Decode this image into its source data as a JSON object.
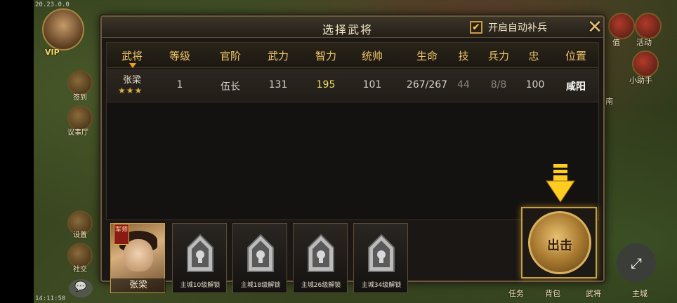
{
  "status": {
    "time_top": "20.23.0.0",
    "time_bottom": "14:11:50"
  },
  "hud": {
    "vip": "VIP",
    "left_items": [
      {
        "label": "签到"
      },
      {
        "label": "议事厅"
      },
      {
        "label": "设置"
      },
      {
        "label": "社交"
      }
    ],
    "right_items": [
      {
        "label": "值"
      },
      {
        "label": "活动"
      },
      {
        "label": "小助手"
      },
      {
        "label": "南"
      }
    ],
    "bottom_right": [
      "任务",
      "背包",
      "武将",
      "主城"
    ]
  },
  "dialog": {
    "title": "选择武将",
    "auto_replenish": {
      "label": "开启自动补兵",
      "checked": true,
      "check_mark": "✔"
    },
    "close_glyph": "✕",
    "columns": [
      "武将",
      "等级",
      "官阶",
      "武力",
      "智力",
      "统帅",
      "生命",
      "技",
      "兵力",
      "忠",
      "位置"
    ],
    "rows": [
      {
        "name": "张梁",
        "stars": "★★★",
        "level": "1",
        "rank": "伍长",
        "force": "131",
        "intellect": "195",
        "command": "101",
        "hp": "267/267",
        "skill": "44",
        "troops": "8/8",
        "loyalty": "100",
        "location": "咸阳"
      }
    ],
    "slots": [
      {
        "type": "general",
        "name": "张梁",
        "badge": "军师"
      },
      {
        "type": "locked",
        "label": "主城10级解锁"
      },
      {
        "type": "locked",
        "label": "主城18级解锁"
      },
      {
        "type": "locked",
        "label": "主城26级解锁"
      },
      {
        "type": "locked",
        "label": "主城34级解锁"
      }
    ],
    "attack_label": "出击"
  },
  "colors": {
    "header_gold": "#efc56a",
    "intellect_yellow": "#f0e060",
    "frame_gold": "#c8a048"
  }
}
